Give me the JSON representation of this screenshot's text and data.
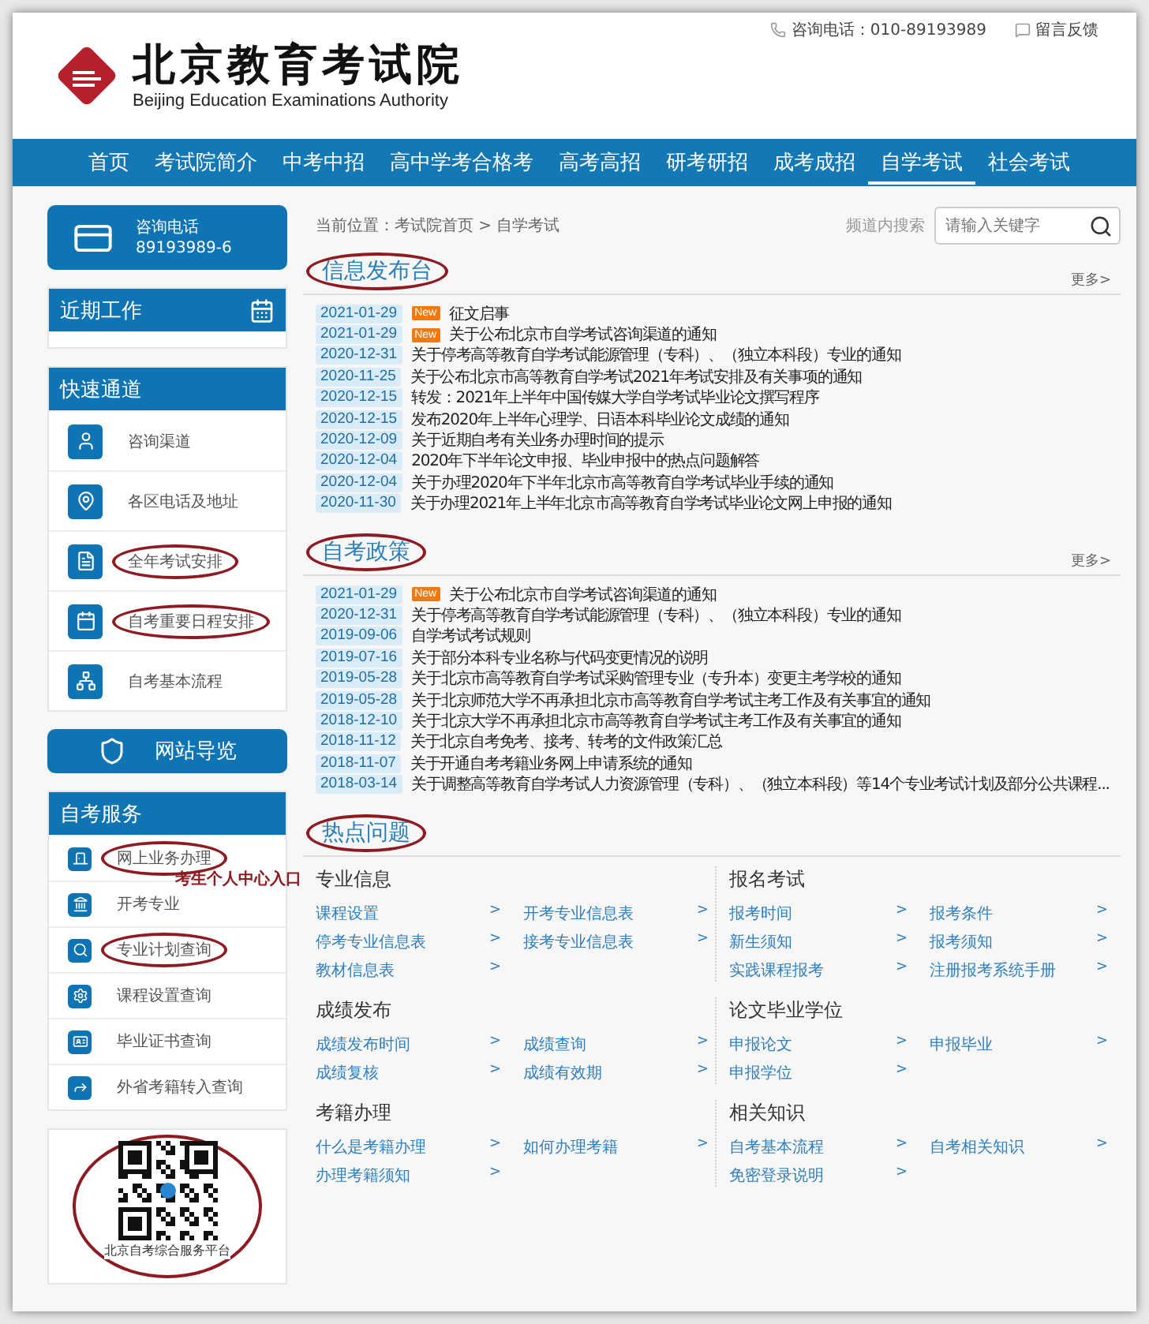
{
  "header": {
    "phone": "咨询电话：010-89193989",
    "feedback": "留言反馈",
    "logo_title": "北京教育考试院",
    "logo_subtitle": "Beijing Education Examinations Authority"
  },
  "nav": [
    {
      "label": "首页",
      "selected": false
    },
    {
      "label": "考试院简介",
      "selected": false
    },
    {
      "label": "中考中招",
      "selected": false
    },
    {
      "label": "高中学考合格考",
      "selected": false
    },
    {
      "label": "高考高招",
      "selected": false
    },
    {
      "label": "研考研招",
      "selected": false
    },
    {
      "label": "成考成招",
      "selected": false
    },
    {
      "label": "自学考试",
      "selected": true
    },
    {
      "label": "社会考试",
      "selected": false
    }
  ],
  "sidebar": {
    "phone_card": {
      "label": "咨询电话",
      "number": "89193989-6"
    },
    "recent_work": {
      "title": "近期工作"
    },
    "quick_links": {
      "title": "快速通道",
      "items": [
        {
          "label": "咨询渠道",
          "circled": false
        },
        {
          "label": "各区电话及地址",
          "circled": false
        },
        {
          "label": "全年考试安排",
          "circled": true
        },
        {
          "label": "自考重要日程安排",
          "circled": true
        },
        {
          "label": "自考基本流程",
          "circled": false
        }
      ]
    },
    "site_guide": "网站导览",
    "services": {
      "title": "自考服务",
      "items": [
        {
          "label": "网上业务办理",
          "circled": true,
          "note": "考生个人中心入口"
        },
        {
          "label": "开考专业",
          "circled": false
        },
        {
          "label": "专业计划查询",
          "circled": true
        },
        {
          "label": "课程设置查询",
          "circled": false
        },
        {
          "label": "毕业证书查询",
          "circled": false
        },
        {
          "label": "外省考籍转入查询",
          "circled": false
        }
      ]
    },
    "qr": {
      "caption": "北京自考综合服务平台",
      "circled": true
    }
  },
  "breadcrumb": "当前位置：考试院首页 > 自学考试",
  "search": {
    "label": "频道内搜索",
    "placeholder": "请输入关键字"
  },
  "sections": [
    {
      "title": "信息发布台",
      "circled": true,
      "more": "更多>",
      "items": [
        {
          "date": "2021-01-29",
          "new": true,
          "badge": "New",
          "title": "征文启事"
        },
        {
          "date": "2021-01-29",
          "new": true,
          "badge": "New",
          "title": "关于公布北京市自学考试咨询渠道的通知"
        },
        {
          "date": "2020-12-31",
          "new": false,
          "title": "关于停考高等教育自学考试能源管理（专科）、（独立本科段）专业的通知"
        },
        {
          "date": "2020-11-25",
          "new": false,
          "title": "关于公布北京市高等教育自学考试2021年考试安排及有关事项的通知"
        },
        {
          "date": "2020-12-15",
          "new": false,
          "title": "转发：2021年上半年中国传媒大学自学考试毕业论文撰写程序"
        },
        {
          "date": "2020-12-15",
          "new": false,
          "title": "发布2020年上半年心理学、日语本科毕业论文成绩的通知"
        },
        {
          "date": "2020-12-09",
          "new": false,
          "title": "关于近期自考有关业务办理时间的提示"
        },
        {
          "date": "2020-12-04",
          "new": false,
          "title": "2020年下半年论文申报、毕业申报中的热点问题解答"
        },
        {
          "date": "2020-12-04",
          "new": false,
          "title": "关于办理2020年下半年北京市高等教育自学考试毕业手续的通知"
        },
        {
          "date": "2020-11-30",
          "new": false,
          "title": "关于办理2021年上半年北京市高等教育自学考试毕业论文网上申报的通知"
        }
      ]
    },
    {
      "title": "自考政策",
      "circled": true,
      "more": "更多>",
      "items": [
        {
          "date": "2021-01-29",
          "new": true,
          "badge": "New",
          "title": "关于公布北京市自学考试咨询渠道的通知"
        },
        {
          "date": "2020-12-31",
          "new": false,
          "title": "关于停考高等教育自学考试能源管理（专科）、（独立本科段）专业的通知"
        },
        {
          "date": "2019-09-06",
          "new": false,
          "title": "自学考试考试规则"
        },
        {
          "date": "2019-07-16",
          "new": false,
          "title": "关于部分本科专业名称与代码变更情况的说明"
        },
        {
          "date": "2019-05-28",
          "new": false,
          "title": "关于北京市高等教育自学考试采购管理专业（专升本）变更主考学校的通知"
        },
        {
          "date": "2019-05-28",
          "new": false,
          "title": "关于北京师范大学不再承担北京市高等教育自学考试主考工作及有关事宜的通知"
        },
        {
          "date": "2018-12-10",
          "new": false,
          "title": "关于北京大学不再承担北京市高等教育自学考试主考工作及有关事宜的通知"
        },
        {
          "date": "2018-11-12",
          "new": false,
          "title": "关于北京自考免考、接考、转考的文件政策汇总"
        },
        {
          "date": "2018-11-07",
          "new": false,
          "title": "关于开通自考考籍业务网上申请系统的通知"
        },
        {
          "date": "2018-03-14",
          "new": false,
          "title": "关于调整高等教育自学考试人力资源管理（专科）、（独立本科段）等14个专业考试计划及部分公共课程..."
        }
      ]
    }
  ],
  "hot": {
    "title": "热点问题",
    "circled": true,
    "groups": [
      {
        "title": "专业信息",
        "links": [
          {
            "label": "课程设置",
            "arrow": ">"
          },
          {
            "label": "开考专业信息表",
            "arrow": ">"
          },
          {
            "label": "停考专业信息表",
            "arrow": ">"
          },
          {
            "label": "接考专业信息表",
            "arrow": ">"
          },
          {
            "label": "教材信息表",
            "arrow": ">"
          }
        ]
      },
      {
        "title": "报名考试",
        "links": [
          {
            "label": "报考时间",
            "arrow": ">"
          },
          {
            "label": "报考条件",
            "arrow": ">"
          },
          {
            "label": "新生须知",
            "arrow": ">"
          },
          {
            "label": "报考须知",
            "arrow": ">"
          },
          {
            "label": "实践课程报考",
            "arrow": ">"
          },
          {
            "label": "注册报考系统手册",
            "arrow": ">"
          }
        ]
      },
      {
        "title": "成绩发布",
        "links": [
          {
            "label": "成绩发布时间",
            "arrow": ">"
          },
          {
            "label": "成绩查询",
            "arrow": ">"
          },
          {
            "label": "成绩复核",
            "arrow": ">"
          },
          {
            "label": "成绩有效期",
            "arrow": ">"
          }
        ]
      },
      {
        "title": "论文毕业学位",
        "links": [
          {
            "label": "申报论文",
            "arrow": ">"
          },
          {
            "label": "申报毕业",
            "arrow": ">"
          },
          {
            "label": "申报学位",
            "arrow": ">"
          }
        ]
      },
      {
        "title": "考籍办理",
        "links": [
          {
            "label": "什么是考籍办理",
            "arrow": ">"
          },
          {
            "label": "如何办理考籍",
            "arrow": ">"
          },
          {
            "label": "办理考籍须知",
            "arrow": ">"
          }
        ]
      },
      {
        "title": "相关知识",
        "links": [
          {
            "label": "自考基本流程",
            "arrow": ">"
          },
          {
            "label": "自考相关知识",
            "arrow": ">"
          },
          {
            "label": "免密登录说明",
            "arrow": ">"
          }
        ]
      }
    ]
  }
}
